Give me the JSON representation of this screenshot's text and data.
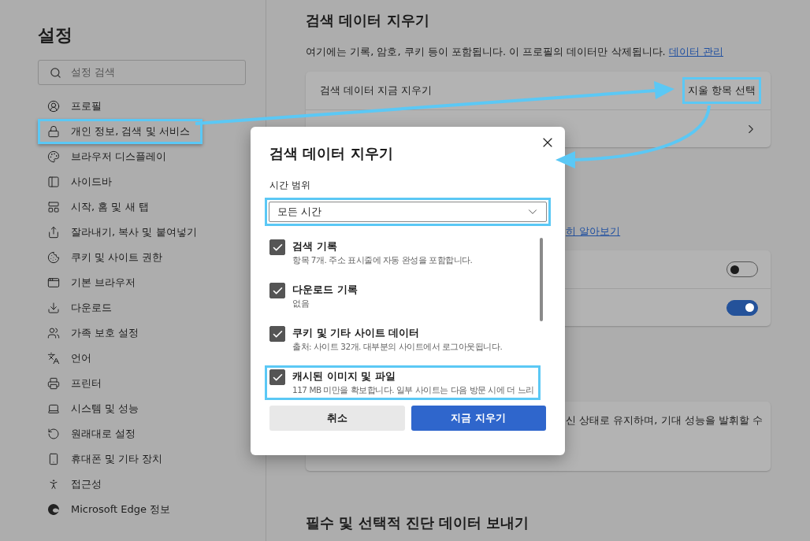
{
  "sidebar": {
    "title": "설정",
    "search": {
      "placeholder": "설정 검색"
    },
    "items": [
      {
        "label": "프로필",
        "highlighted": false
      },
      {
        "label": "개인 정보, 검색 및 서비스",
        "highlighted": true
      },
      {
        "label": "브라우저 디스플레이",
        "highlighted": false
      },
      {
        "label": "사이드바",
        "highlighted": false
      },
      {
        "label": "시작, 홈 및 새 탭",
        "highlighted": false
      },
      {
        "label": "잘라내기, 복사 및 붙여넣기",
        "highlighted": false
      },
      {
        "label": "쿠키 및 사이트 권한",
        "highlighted": false
      },
      {
        "label": "기본 브라우저",
        "highlighted": false
      },
      {
        "label": "다운로드",
        "highlighted": false
      },
      {
        "label": "가족 보호 설정",
        "highlighted": false
      },
      {
        "label": "언어",
        "highlighted": false
      },
      {
        "label": "프린터",
        "highlighted": false
      },
      {
        "label": "시스템 및 성능",
        "highlighted": false
      },
      {
        "label": "원래대로 설정",
        "highlighted": false
      },
      {
        "label": "휴대폰 및 기타 장치",
        "highlighted": false
      },
      {
        "label": "접근성",
        "highlighted": false
      },
      {
        "label": "Microsoft Edge 정보",
        "highlighted": false
      }
    ]
  },
  "main": {
    "heading": "검색 데이터 지우기",
    "description": "여기에는 기록, 암호, 쿠키 등이 포함됩니다. 이 프로필의 데이터만 삭제됩니다.",
    "description_link": "데이터 관리",
    "clear_card": {
      "label": "검색 데이터 지금 지우기",
      "button": {
        "label": "지울 항목 선택",
        "highlighted": true
      }
    },
    "learn_more_link": "히 알아보기",
    "toggles": [
      {
        "on": false
      },
      {
        "on": true
      }
    ],
    "update_text": "신 상태로 유지하며, 기대 성능을 발휘할 수",
    "diagnostics_heading": "필수 및 선택적 진단 데이터 보내기"
  },
  "dialog": {
    "title": "검색 데이터 지우기",
    "time_range_label": "시간 범위",
    "time_range": {
      "value": "모든 시간",
      "highlighted": true
    },
    "items": [
      {
        "title": "검색 기록",
        "description": "항목 7개. 주소 표시줄에 자동 완성을 포함합니다.",
        "checked": true,
        "highlighted": false
      },
      {
        "title": "다운로드 기록",
        "description": "없음",
        "checked": true,
        "highlighted": false
      },
      {
        "title": "쿠키 및 기타 사이트 데이터",
        "description": "출처: 사이트 32개. 대부분의 사이트에서 로그아웃됩니다.",
        "checked": true,
        "highlighted": false
      },
      {
        "title": "캐시된 이미지 및 파일",
        "description": "117 MB 미만을 확보합니다. 일부 사이트는 다음 방문 시에 더 느리",
        "checked": true,
        "highlighted": true
      }
    ],
    "buttons": [
      {
        "label": "취소",
        "kind": "secondary"
      },
      {
        "label": "지금 지우기",
        "kind": "primary"
      }
    ]
  }
}
